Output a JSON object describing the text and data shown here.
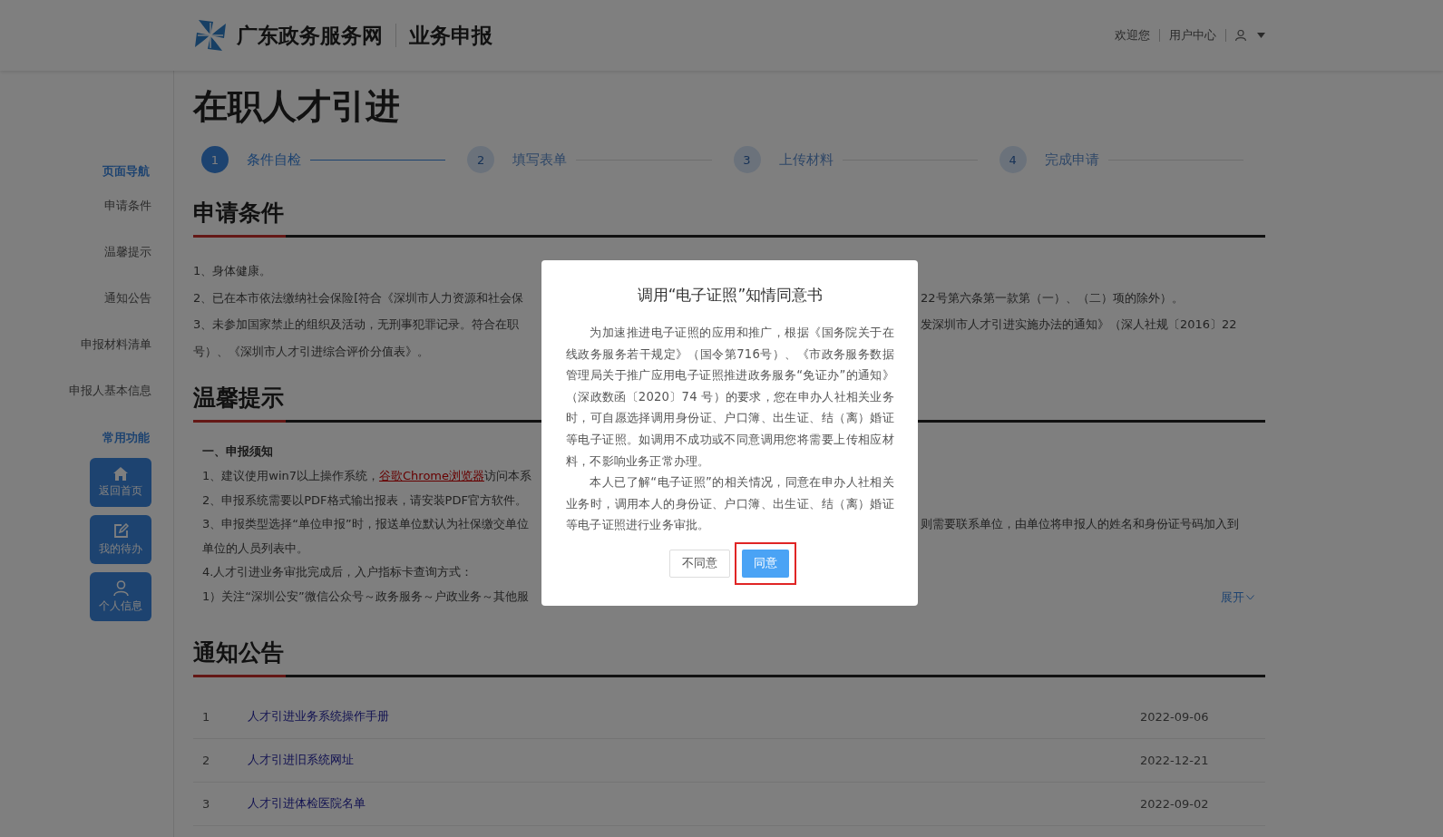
{
  "header": {
    "site_name": "广东政务服务网",
    "section": "业务申报",
    "greeting": "欢迎您",
    "user_center": "用户中心"
  },
  "page_title": "在职人才引进",
  "steps": [
    {
      "number": "1",
      "label": "条件自检",
      "active": true
    },
    {
      "number": "2",
      "label": "填写表单",
      "active": false
    },
    {
      "number": "3",
      "label": "上传材料",
      "active": false
    },
    {
      "number": "4",
      "label": "完成申请",
      "active": false
    }
  ],
  "sidebar": {
    "nav_title": "页面导航",
    "nav_items": [
      "申请条件",
      "温馨提示",
      "通知公告",
      "申报材料清单",
      "申报人基本信息"
    ],
    "functions_title": "常用功能",
    "functions": [
      {
        "label": "返回首页",
        "kind": "home"
      },
      {
        "label": "我的待办",
        "kind": "edit"
      },
      {
        "label": "个人信息",
        "kind": "user"
      }
    ]
  },
  "conditions": {
    "heading": "申请条件",
    "lines": [
      {
        "left": "1、身体健康。"
      },
      {
        "left": "2、已在本市依法缴纳社会保险[符合《深圳市人力资源和社会保",
        "right": "22号第六条第一款第（一）、（二）项的除外）。"
      },
      {
        "left": "3、未参加国家禁止的组织及活动，无刑事犯罪记录。符合在职",
        "right": "发深圳市人才引进实施办法的通知》（深人社规〔2016〕22"
      },
      {
        "left": "号）、《深圳市人才引进综合评价分值表》。"
      }
    ]
  },
  "tips": {
    "heading": "温馨提示",
    "subheading": "一、申报须知",
    "lines": [
      {
        "left": "1、建议使用win7以上操作系统，",
        "link": "谷歌Chrome浏览器",
        "after": "访问本系"
      },
      {
        "left": "2、申报系统需要以PDF格式输出报表，请安装PDF官方软件。"
      },
      {
        "left": "3、申报类型选择“单位申报”时，报送单位默认为社保缴交单位",
        "right": "则需要联系单位，由单位将申报人的姓名和身份证号码加入到"
      },
      {
        "left": "单位的人员列表中。"
      },
      {
        "left": "4.人才引进业务审批完成后，入户指标卡查询方式："
      },
      {
        "left": "1）关注“深圳公安”微信公众号～政务服务～户政业务～其他服"
      }
    ],
    "expand": "展开"
  },
  "notices": {
    "heading": "通知公告",
    "rows": [
      {
        "index": "1",
        "title": "人才引进业务系统操作手册",
        "date": "2022-09-06"
      },
      {
        "index": "2",
        "title": "人才引进旧系统网址",
        "date": "2022-12-21"
      },
      {
        "index": "3",
        "title": "人才引进体检医院名单",
        "date": "2022-09-02"
      }
    ]
  },
  "dialog": {
    "title": "调用“电子证照”知情同意书",
    "paragraphs": [
      "为加速推进电子证照的应用和推广，根据《国务院关于在线政务服务若干规定》（国令第716号）、《市政务服务数据管理局关于推广应用电子证照推进政务服务“免证办”的通知》（深政数函〔2020〕74 号）的要求，您在申办人社相关业务时，可自愿选择调用身份证、户口簿、出生证、结（离）婚证等电子证照。如调用不成功或不同意调用您将需要上传相应材料，不影响业务正常办理。",
      "本人已了解“电子证照”的相关情况，同意在申办人社相关业务时，调用本人的身份证、户口簿、出生证、结（离）婚证等电子证照进行业务审批。"
    ],
    "buttons": [
      {
        "label": "不同意",
        "kind": "default",
        "highlighted": false
      },
      {
        "label": "同意",
        "kind": "primary",
        "highlighted": true
      }
    ]
  }
}
